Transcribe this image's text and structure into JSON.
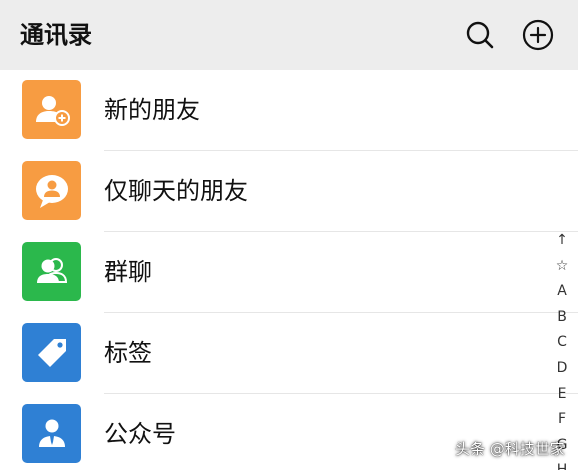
{
  "header": {
    "title": "通讯录",
    "search_icon": "search-icon",
    "add_icon": "plus-circle-icon"
  },
  "items": [
    {
      "label": "新的朋友",
      "icon": "add-friend-icon",
      "color": "#f79c42"
    },
    {
      "label": "仅聊天的朋友",
      "icon": "chat-only-friend-icon",
      "color": "#f79c42"
    },
    {
      "label": "群聊",
      "icon": "group-chat-icon",
      "color": "#2bb84c"
    },
    {
      "label": "标签",
      "icon": "tag-icon",
      "color": "#2f80d4"
    },
    {
      "label": "公众号",
      "icon": "official-account-icon",
      "color": "#2f80d4"
    }
  ],
  "index_bar": [
    "↑",
    "☆",
    "A",
    "B",
    "C",
    "D",
    "E",
    "F",
    "G",
    "H"
  ],
  "watermark": "头条 @科技世家"
}
